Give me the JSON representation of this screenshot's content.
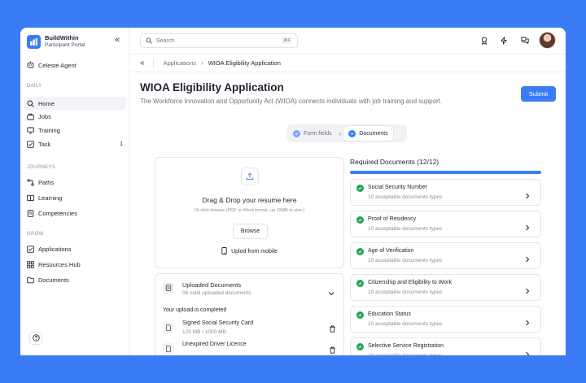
{
  "brand": {
    "name": "BuildWithin",
    "subtitle": "Participant Portal"
  },
  "sidebar": {
    "agent": "Celeste Agent",
    "sections": [
      {
        "label": "DAILY",
        "items": [
          {
            "label": "Home",
            "icon": "search-icon",
            "active": true
          },
          {
            "label": "Jobs",
            "icon": "briefcase-icon"
          },
          {
            "label": "Training",
            "icon": "monitor-icon"
          },
          {
            "label": "Task",
            "icon": "checklist-icon",
            "count": "1"
          }
        ]
      },
      {
        "label": "JOURNEYS",
        "items": [
          {
            "label": "Paths",
            "icon": "path-icon"
          },
          {
            "label": "Learning",
            "icon": "book-icon"
          },
          {
            "label": "Competencies",
            "icon": "document-icon"
          }
        ]
      },
      {
        "label": "GROW",
        "items": [
          {
            "label": "Applications",
            "icon": "checkbox-icon"
          },
          {
            "label": "Resources Hub",
            "icon": "grid-icon"
          },
          {
            "label": "Documents",
            "icon": "folder-icon"
          }
        ]
      }
    ]
  },
  "topbar": {
    "search_placeholder": "Search",
    "shortcut": "⌘F"
  },
  "breadcrumb": {
    "parent": "Applications",
    "current": "WIOA Eligibility Application"
  },
  "page": {
    "title": "WIOA Eligibility Application",
    "description": "The Workforce Innovation and Opportunity Act (WIOA) connects individuals with job training and support.",
    "submit_label": "Submit"
  },
  "stepper": {
    "step1": "Form fields",
    "step2": "Documents"
  },
  "upload": {
    "title": "Drag & Drop your resume here",
    "hint": "Or click browse (PDF or Word format, up 10MB in size.)",
    "browse_label": "Browse",
    "mobile_label": "Uplod from mobile"
  },
  "uploaded": {
    "title": "Uploaded Documents",
    "subtitle": "06 valid uploaded documents",
    "status": "Your upload is completed",
    "files": [
      {
        "name": "Signed Social Security Card",
        "size": "129 MB / 1000 MB"
      },
      {
        "name": "Unexpired Driver Licence",
        "size": ""
      }
    ]
  },
  "required": {
    "title": "Required Documents (12/12)",
    "progress": 1.0,
    "items": [
      {
        "name": "Social Security Number",
        "sub": "10 acceptable documents types"
      },
      {
        "name": "Proof of Residency",
        "sub": "10 acceptable documents types"
      },
      {
        "name": "Age of Verification",
        "sub": "10 acceptable documents types"
      },
      {
        "name": "Citizenship and Eligibility to Work",
        "sub": "10 acceptable documents types"
      },
      {
        "name": "Education Status",
        "sub": "10 acceptable documents types"
      },
      {
        "name": "Selective Service Registration",
        "sub": "10 acceptable documents types"
      }
    ]
  },
  "colors": {
    "accent": "#3b7cf6",
    "success": "#22a654",
    "background": "#3b7cf6"
  }
}
